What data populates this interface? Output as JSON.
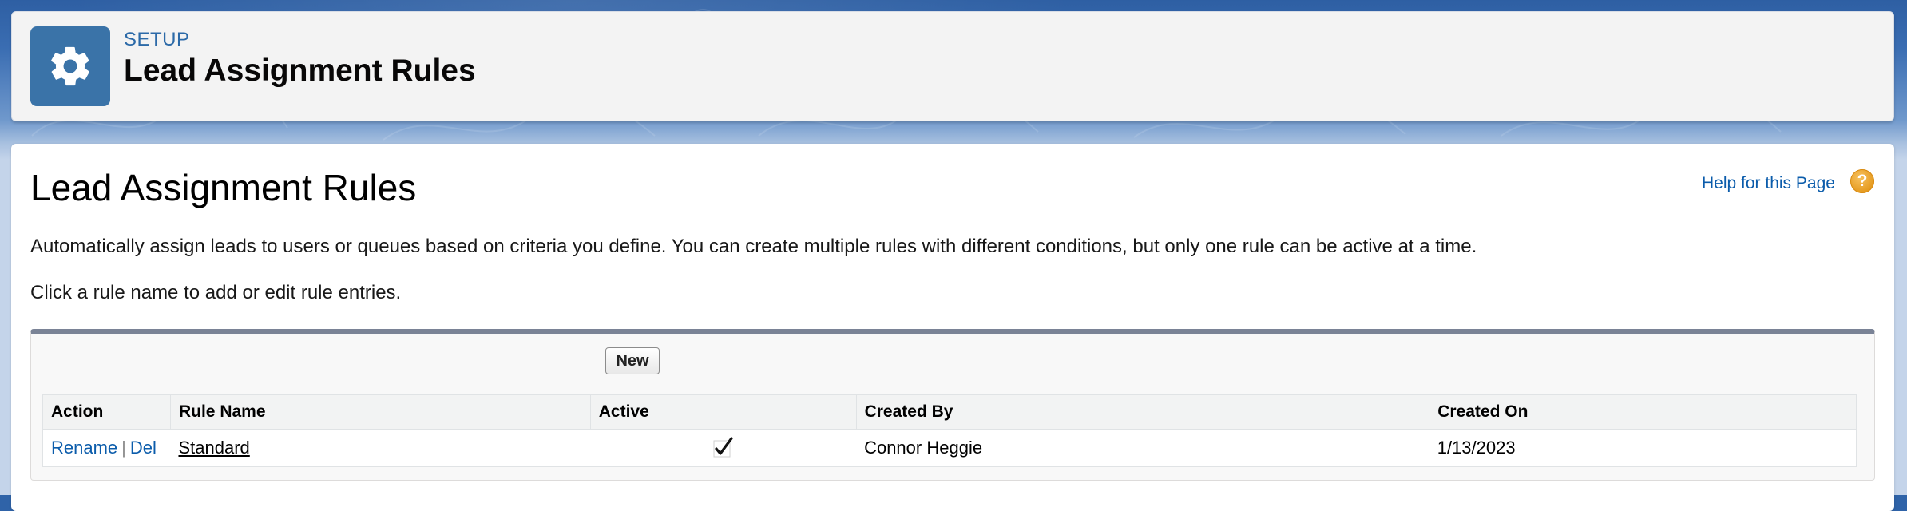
{
  "header": {
    "section_label": "SETUP",
    "title": "Lead Assignment Rules",
    "icon": "gear-icon"
  },
  "main": {
    "page_title": "Lead Assignment Rules",
    "help_link": "Help for this Page",
    "help_icon": "question-mark-icon",
    "help_icon_glyph": "?",
    "description": "Automatically assign leads to users or queues based on criteria you define. You can create multiple rules with different conditions, but only one rule can be active at a time.",
    "instruction": "Click a rule name to add or edit rule entries.",
    "new_button_label": "New"
  },
  "table": {
    "headers": {
      "action": "Action",
      "rule_name": "Rule Name",
      "active": "Active",
      "created_by": "Created By",
      "created_on": "Created On"
    },
    "rows": [
      {
        "rename_label": "Rename",
        "separator": "|",
        "del_label": "Del",
        "rule_name": "Standard",
        "active": true,
        "active_icon": "checkmark-icon",
        "created_by": "Connor Heggie",
        "created_on": "1/13/2023"
      }
    ]
  },
  "colors": {
    "link": "#0b5cab",
    "header_icon_bg": "#3a73a8",
    "block_border": "#7a8396",
    "help_icon": "#e59a1f"
  }
}
